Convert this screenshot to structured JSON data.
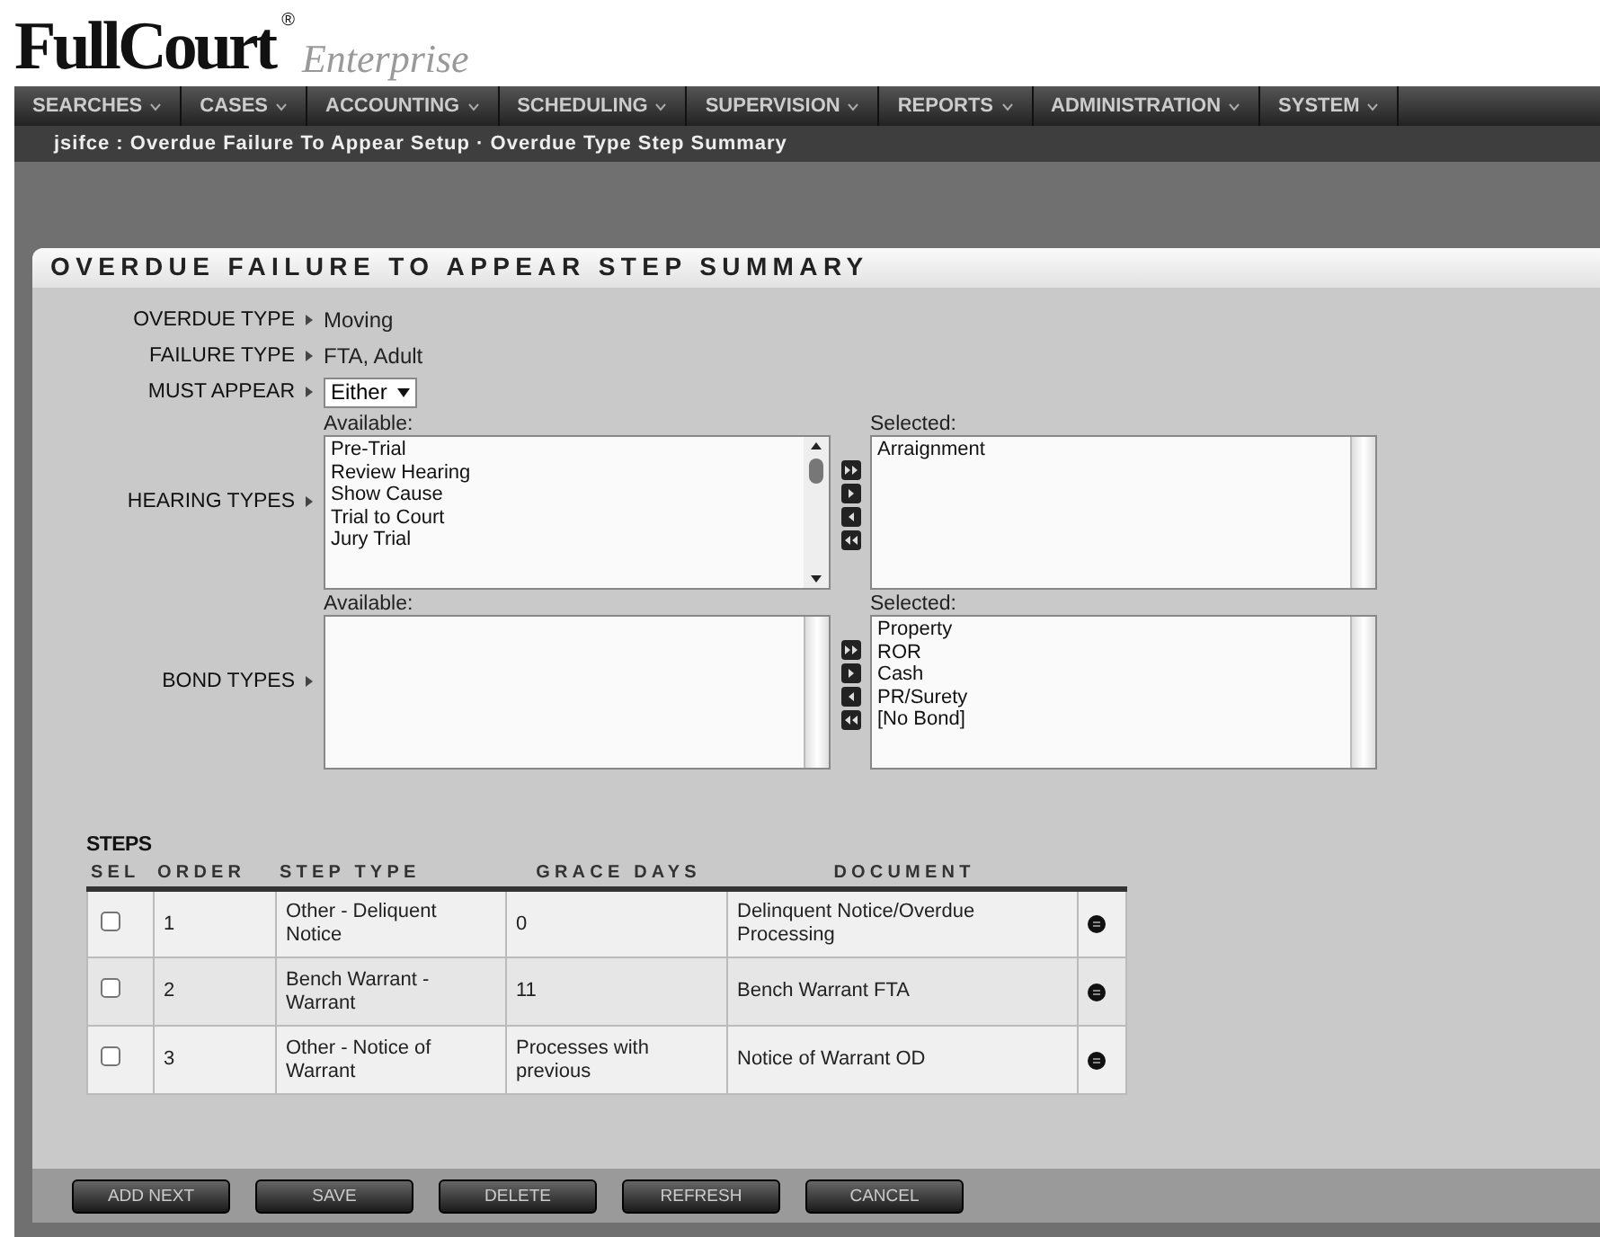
{
  "logo": {
    "brand": "FullCourt",
    "mark": "®",
    "product": "Enterprise"
  },
  "menu": [
    "SEARCHES",
    "CASES",
    "ACCOUNTING",
    "SCHEDULING",
    "SUPERVISION",
    "REPORTS",
    "ADMINISTRATION",
    "SYSTEM"
  ],
  "breadcrumb": "jsifce : Overdue Failure To Appear Setup · Overdue Type Step Summary",
  "panel": {
    "title": "OVERDUE FAILURE TO APPEAR STEP SUMMARY",
    "fields": [
      {
        "label": "OVERDUE TYPE",
        "kind": "text",
        "value": "Moving"
      },
      {
        "label": "FAILURE TYPE",
        "kind": "text",
        "value": "FTA,  Adult"
      },
      {
        "label": "MUST APPEAR",
        "kind": "select",
        "value": "Either"
      }
    ],
    "pickers": [
      {
        "label": "HEARING TYPES",
        "available_label": "Available:",
        "selected_label": "Selected:",
        "available": [
          "Pre-Trial",
          "Review Hearing",
          "Show Cause",
          "Trial to Court",
          "Jury Trial"
        ],
        "selected": [
          "Arraignment"
        ],
        "scroll": true
      },
      {
        "label": "BOND TYPES",
        "available_label": "Available:",
        "selected_label": "Selected:",
        "selected": [
          "Property",
          "ROR",
          "Cash",
          "PR/Surety",
          "[No Bond]"
        ],
        "scroll": false
      }
    ],
    "steps_label": "STEPS",
    "columns": [
      "SEL",
      "ORDER",
      "STEP TYPE",
      "GRACE DAYS",
      "DOCUMENT"
    ],
    "rows": [
      {
        "checked": false,
        "order": "1",
        "step_type": "Other  - Deliquent Notice",
        "grace_days": "0",
        "document": "Delinquent Notice/Overdue Processing"
      },
      {
        "checked": false,
        "order": "2",
        "step_type": "Bench Warrant  - Warrant",
        "grace_days": "11",
        "document": "Bench Warrant FTA"
      },
      {
        "checked": false,
        "order": "3",
        "step_type": "Other  - Notice of Warrant",
        "grace_days": "Processes with previous",
        "document": "Notice of Warrant OD"
      }
    ],
    "buttons": [
      "ADD NEXT",
      "SAVE",
      "DELETE",
      "REFRESH",
      "CANCEL"
    ]
  }
}
